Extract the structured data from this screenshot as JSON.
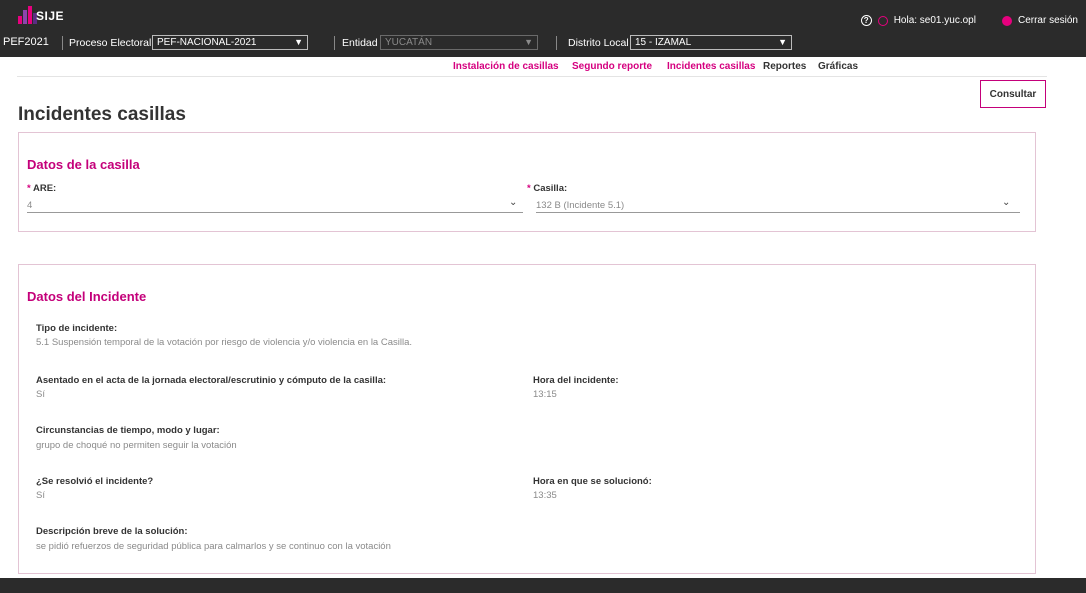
{
  "header": {
    "app_name": "SIJE",
    "process_code": "PEF2021",
    "proceso_label": "Proceso Electoral",
    "proceso_value": "PEF-NACIONAL-2021",
    "entidad_label": "Entidad",
    "entidad_value": "YUCATÁN",
    "distrito_label": "Distrito Local",
    "distrito_value": "15 - IZAMAL",
    "greeting": "Hola: se01.yuc.opl",
    "logout": "Cerrar sesión",
    "logo_colors": [
      "#e6007e",
      "#8e44ad",
      "#e6007e",
      "#5b2c83"
    ]
  },
  "nav": {
    "items": [
      "Instalación de casillas",
      "Segundo reporte",
      "Incidentes casillas",
      "Reportes",
      "Gráficas"
    ],
    "accent": "#d5007f"
  },
  "page": {
    "title": "Incidentes casillas",
    "consultar": "Consultar"
  },
  "casilla_card": {
    "title": "Datos de la casilla",
    "are_label": "ARE:",
    "are_value": "4",
    "casilla_label": "Casilla:",
    "casilla_value": "132 B (Incidente 5.1)",
    "required_mark": "*"
  },
  "incidente_card": {
    "title": "Datos del Incidente",
    "tipo_label": "Tipo de incidente:",
    "tipo_value": "5.1 Suspensión temporal de la votación por riesgo de violencia y/o violencia en la Casilla.",
    "asentado_label": "Asentado en el acta de la jornada electoral/escrutinio y cómputo de la casilla:",
    "asentado_value": "Sí",
    "hora_label": "Hora del incidente:",
    "hora_value": "13:15",
    "circ_label": "Circunstancias de tiempo, modo y lugar:",
    "circ_value": "grupo de choqué no permiten seguir la votación",
    "resolvio_label": "¿Se resolvió el incidente?",
    "resolvio_value": "Sí",
    "hora_sol_label": "Hora en que se solucionó:",
    "hora_sol_value": "13:35",
    "desc_label": "Descripción breve de la solución:",
    "desc_value": "se pidió refuerzos de seguridad pública para calmarlos y se continuo con la votación"
  }
}
